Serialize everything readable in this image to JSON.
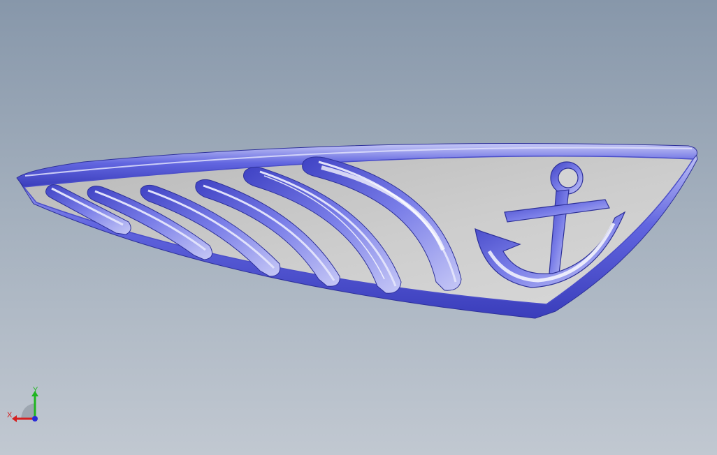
{
  "viewport": {
    "background_top": "#8797aa",
    "background_bottom": "#c1c8d1"
  },
  "model": {
    "face_color": "#c9c9c9",
    "edge_color": "#5356d6",
    "highlight_color": "#c9ccf5",
    "features": [
      "slot-1",
      "slot-2",
      "slot-3",
      "slot-4",
      "slot-5",
      "slot-6",
      "anchor-cutout"
    ]
  },
  "triad": {
    "x_label": "X",
    "y_label": "Y",
    "x_color": "#d52020",
    "y_color": "#1fb520",
    "z_color": "#2a2ad8"
  }
}
